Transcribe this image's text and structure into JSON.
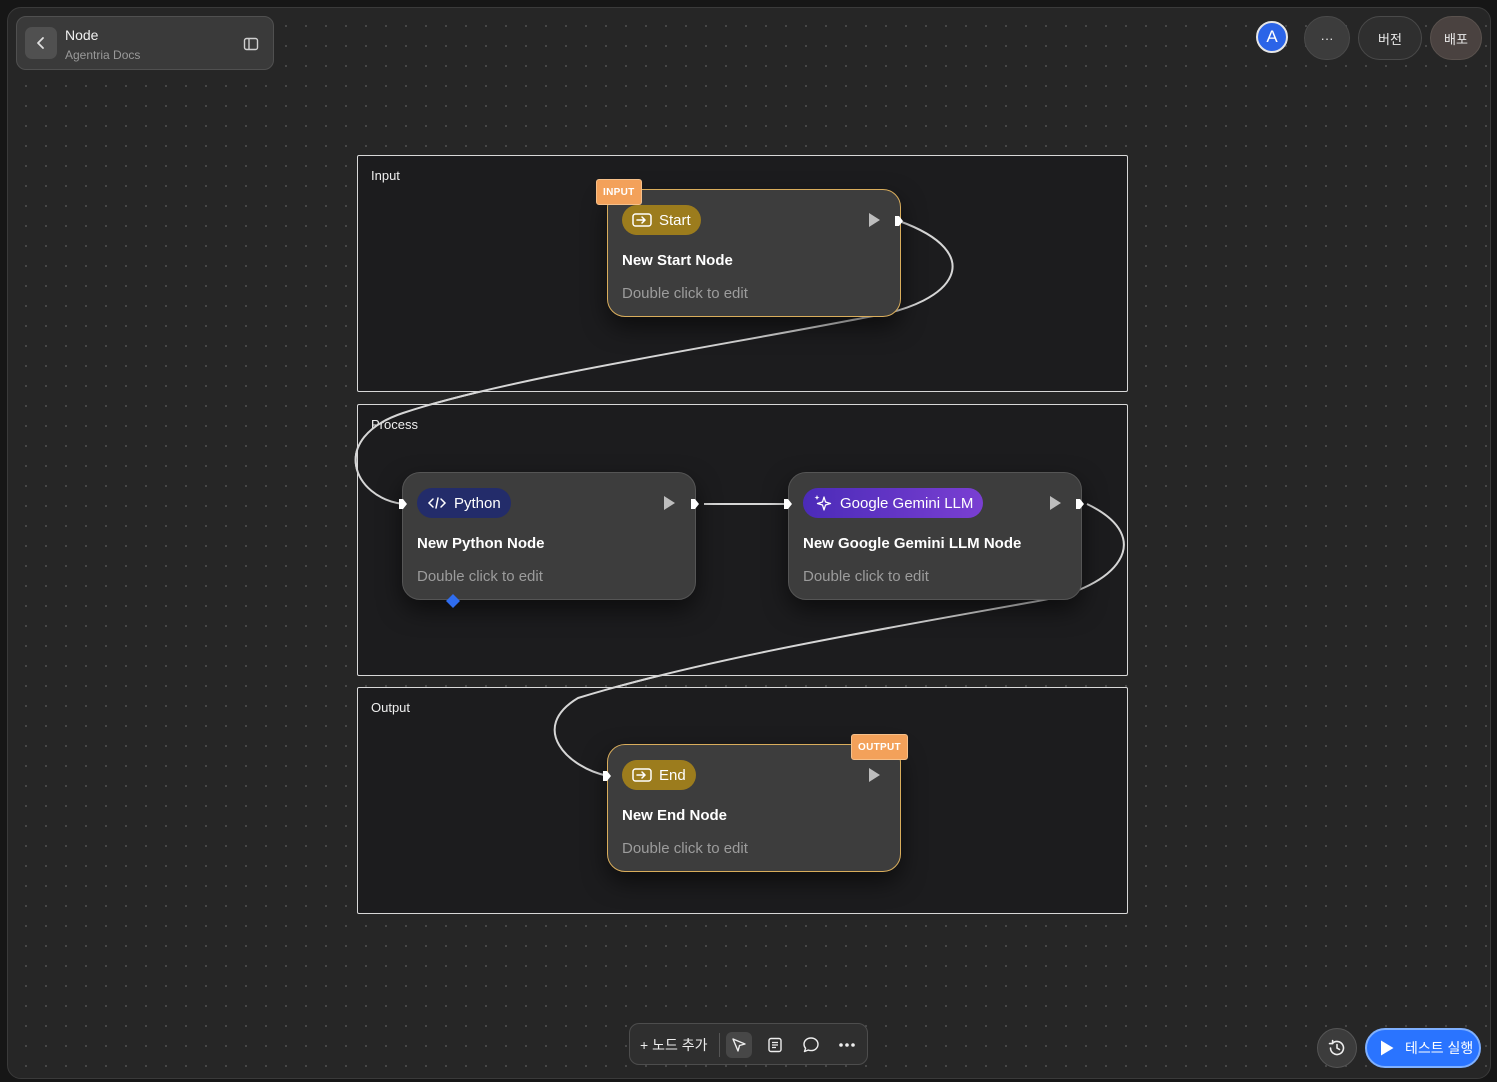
{
  "header": {
    "title": "Node",
    "subtitle": "Agentria Docs"
  },
  "topbar": {
    "avatar_initial": "A",
    "more_label": "···",
    "version_label": "버전",
    "deploy_label": "배포"
  },
  "groups": [
    {
      "label": "Input"
    },
    {
      "label": "Process"
    },
    {
      "label": "Output"
    }
  ],
  "nodes": {
    "start": {
      "tag": "Start",
      "title": "New Start Node",
      "hint": "Double click to edit",
      "badge": "INPUT"
    },
    "python": {
      "tag": "Python",
      "title": "New Python Node",
      "hint": "Double click to edit"
    },
    "gemini": {
      "tag": "Google Gemini LLM",
      "title": "New Google Gemini LLM Node",
      "hint": "Double click to edit"
    },
    "end": {
      "tag": "End",
      "title": "New End Node",
      "hint": "Double click to edit",
      "badge": "OUTPUT"
    }
  },
  "toolbar": {
    "add_node_label": "+ 노드 추가"
  },
  "run": {
    "label": "테스트 실행"
  },
  "colors": {
    "accent_blue": "#2a74ff",
    "start_tag": "#9c7c1d",
    "python_tag": "#232c6a",
    "llm_tag": "#6a36cc",
    "badge": "#f3a15a"
  }
}
